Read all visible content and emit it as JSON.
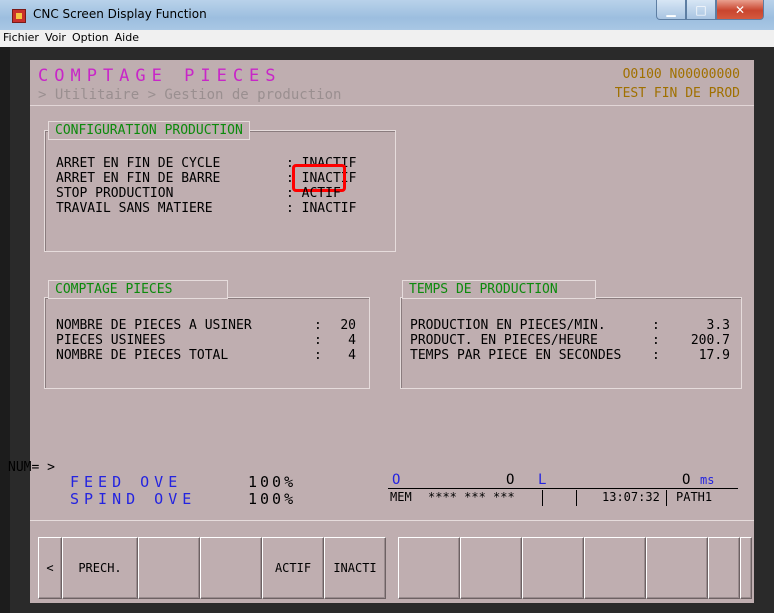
{
  "window": {
    "title": "CNC Screen Display Function"
  },
  "menu": [
    "Fichier",
    "Voir",
    "Option",
    "Aide"
  ],
  "header": {
    "title": "COMPTAGE PIECES",
    "breadcrumb": "> Utilitaire > Gestion de production",
    "program": "O0100 N00000000",
    "status": "TEST FIN DE PROD"
  },
  "config": {
    "tab": "CONFIGURATION PRODUCTION",
    "rows": [
      {
        "label": "ARRET EN FIN DE CYCLE",
        "value": ": INACTIF"
      },
      {
        "label": "ARRET EN FIN DE BARRE",
        "value": ": INACTIF"
      },
      {
        "label": "STOP PRODUCTION",
        "value": ": ACTIF"
      },
      {
        "label": "TRAVAIL SANS MATIERE",
        "value": ": INACTIF"
      }
    ]
  },
  "counting": {
    "tab": "COMPTAGE PIECES",
    "rows": [
      {
        "label": "NOMBRE DE PIECES A USINER",
        "sep": ":",
        "value": "20"
      },
      {
        "label": "PIECES USINEES",
        "sep": ":",
        "value": "4"
      },
      {
        "label": "NOMBRE DE PIECES TOTAL",
        "sep": ":",
        "value": "4"
      }
    ]
  },
  "timing": {
    "tab": "TEMPS DE PRODUCTION",
    "rows": [
      {
        "label": "PRODUCTION EN PIECES/MIN.",
        "sep": ":",
        "value": "3.3"
      },
      {
        "label": "PRODUCT. EN PIECES/HEURE",
        "sep": ":",
        "value": "200.7"
      },
      {
        "label": "TEMPS PAR PIECE EN SECONDES",
        "sep": ":",
        "value": "17.9"
      }
    ]
  },
  "num_prompt": "NUM= >",
  "overrides": {
    "feed": {
      "label": "FEED OVE",
      "value": "100%"
    },
    "spind": {
      "label": "SPIND OVE",
      "value": "100%"
    }
  },
  "status_line": {
    "o1": "O",
    "o2": "O",
    "l": "L",
    "ms_value": "O",
    "ms_unit": "ms",
    "mode": "MEM",
    "stars": "**** *** ***",
    "time": "13:07:32",
    "path": "PATH1"
  },
  "softkeys": [
    "<",
    "PRECH.",
    "",
    "",
    "ACTIF",
    "INACTI",
    "",
    "",
    "",
    "",
    "",
    "",
    ""
  ],
  "colors": {
    "screen_bg": "#bfaeb0",
    "highlight": "#ff0000",
    "title": "#c826c8",
    "tab_text": "#0c8a0c"
  }
}
